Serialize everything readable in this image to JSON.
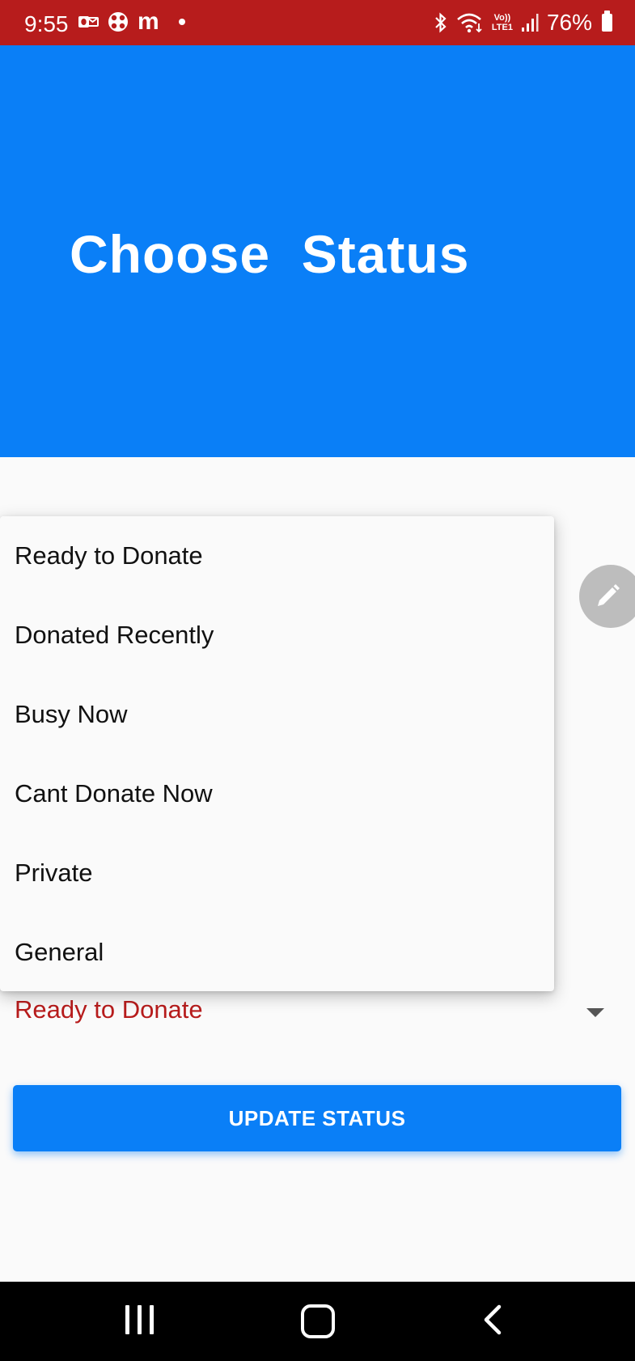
{
  "status_bar": {
    "time": "9:55",
    "left_icons": [
      "outlook-icon",
      "app-icon",
      "m-icon",
      "dot-icon"
    ],
    "m_label": "m",
    "volte_top": "Vo))",
    "volte_bottom": "LTE1",
    "battery": "76%",
    "right_icons": [
      "bluetooth-icon",
      "wifi-icon",
      "volte-icon",
      "signal-icon",
      "battery-icon"
    ]
  },
  "header": {
    "title": "Choose  Status",
    "background": "#0a7ff7"
  },
  "fab": {
    "icon": "pencil-icon"
  },
  "dropdown": {
    "options": [
      "Ready to Donate",
      "Donated Recently",
      "Busy Now",
      "Cant Donate Now",
      "Private",
      "General"
    ],
    "selected": "Ready to Donate",
    "selected_color": "#b71c1c"
  },
  "update_button": {
    "label": "UPDATE STATUS"
  },
  "nav_bar": {
    "icons": [
      "recents-icon",
      "home-icon",
      "back-icon"
    ]
  },
  "colors": {
    "status_bar": "#b71c1c",
    "accent": "#0a7ff7"
  }
}
